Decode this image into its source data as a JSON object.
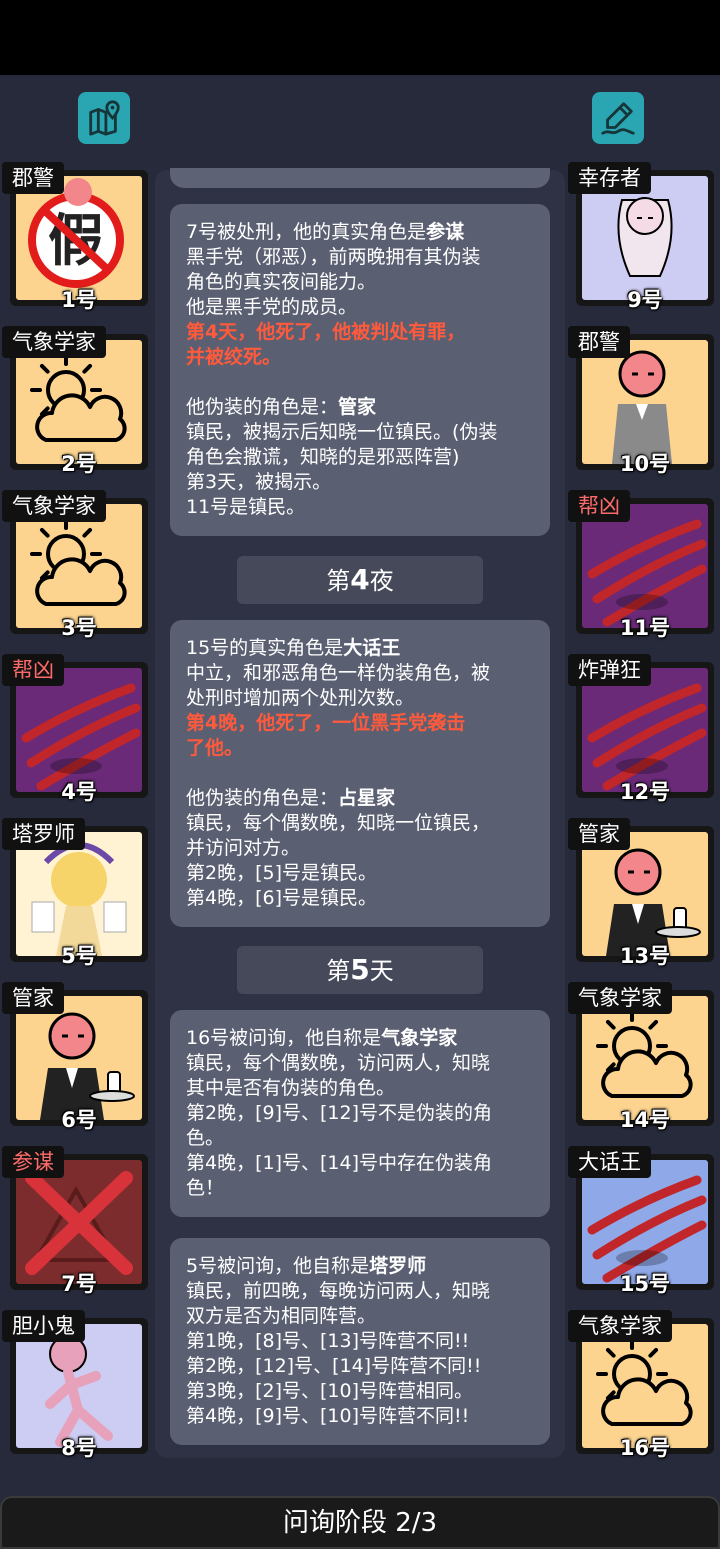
{
  "colors": {
    "accent": "#2aa6b3",
    "evil_role": "#ff6b6b",
    "highlight": "#ff5a3c"
  },
  "toolbar": {
    "left_icon": "map-pin-icon",
    "right_icon": "notepad-pen-icon"
  },
  "left_players": [
    {
      "role": "郡警",
      "num": "1号",
      "evil": false,
      "bg": "sand",
      "art": "fake"
    },
    {
      "role": "气象学家",
      "num": "2号",
      "evil": false,
      "bg": "sand",
      "art": "weather"
    },
    {
      "role": "气象学家",
      "num": "3号",
      "evil": false,
      "bg": "sand",
      "art": "weather"
    },
    {
      "role": "帮凶",
      "num": "4号",
      "evil": true,
      "bg": "purp",
      "art": "slash"
    },
    {
      "role": "塔罗师",
      "num": "5号",
      "evil": false,
      "bg": "tarot",
      "art": "tarot"
    },
    {
      "role": "管家",
      "num": "6号",
      "evil": false,
      "bg": "sand",
      "art": "butler"
    },
    {
      "role": "参谋",
      "num": "7号",
      "evil": true,
      "bg": "red",
      "art": "executed"
    },
    {
      "role": "胆小鬼",
      "num": "8号",
      "evil": false,
      "bg": "lav",
      "art": "coward"
    }
  ],
  "right_players": [
    {
      "role": "幸存者",
      "num": "9号",
      "evil": false,
      "bg": "lav",
      "art": "survivor"
    },
    {
      "role": "郡警",
      "num": "10号",
      "evil": false,
      "bg": "sand",
      "art": "sheriff"
    },
    {
      "role": "帮凶",
      "num": "11号",
      "evil": true,
      "bg": "purp",
      "art": "slash"
    },
    {
      "role": "炸弹狂",
      "num": "12号",
      "evil": false,
      "bg": "purp",
      "art": "slash"
    },
    {
      "role": "管家",
      "num": "13号",
      "evil": false,
      "bg": "sand",
      "art": "butler"
    },
    {
      "role": "气象学家",
      "num": "14号",
      "evil": false,
      "bg": "sand",
      "art": "weather"
    },
    {
      "role": "大话王",
      "num": "15号",
      "evil": false,
      "bg": "blue",
      "art": "slash"
    },
    {
      "role": "气象学家",
      "num": "16号",
      "evil": false,
      "bg": "sand",
      "art": "weather"
    }
  ],
  "log": {
    "entries": [
      {
        "lines": [
          {
            "t": "7号被处刑，他的真实角色是",
            "b": "参谋"
          },
          {
            "t": "黑手党（邪恶），前两晚拥有其伪装"
          },
          {
            "t": "角色的真实夜间能力。"
          },
          {
            "t": "他是黑手党的成员。"
          },
          {
            "t": "第4天，他死了，他被判处有罪，",
            "hl": true
          },
          {
            "t": "并被绞死。",
            "hl": true
          },
          {
            "t": ""
          },
          {
            "t": "他伪装的角色是：",
            "b": "管家"
          },
          {
            "t": "镇民，被揭示后知晓一位镇民。(伪装"
          },
          {
            "t": "角色会撒谎，知晓的是邪恶阵营)"
          },
          {
            "t": "第3天，被揭示。"
          },
          {
            "t": "11号是镇民。"
          }
        ]
      },
      {
        "lines": [
          {
            "t": "15号的真实角色是",
            "b": "大话王"
          },
          {
            "t": "中立，和邪恶角色一样伪装角色，被"
          },
          {
            "t": "处刑时增加两个处刑次数。"
          },
          {
            "t": "第4晚，他死了，一位黑手党袭击",
            "hl": true
          },
          {
            "t": "了他。",
            "hl": true
          },
          {
            "t": ""
          },
          {
            "t": "他伪装的角色是：",
            "b": "占星家"
          },
          {
            "t": "镇民，每个偶数晚，知晓一位镇民，"
          },
          {
            "t": "并访问对方。"
          },
          {
            "t": "第2晚，[5]号是镇民。"
          },
          {
            "t": "第4晚，[6]号是镇民。"
          }
        ]
      },
      {
        "lines": [
          {
            "t": "16号被问询，他自称是",
            "b": "气象学家"
          },
          {
            "t": "镇民，每个偶数晚，访问两人，知晓"
          },
          {
            "t": "其中是否有伪装的角色。"
          },
          {
            "t": "第2晚，[9]号、[12]号不是伪装的角"
          },
          {
            "t": "色。"
          },
          {
            "t": "第4晚，[1]号、[14]号中存在伪装角"
          },
          {
            "t": "色！"
          }
        ]
      },
      {
        "lines": [
          {
            "t": "5号被问询，他自称是",
            "b": "塔罗师"
          },
          {
            "t": "镇民，前四晚，每晚访问两人，知晓"
          },
          {
            "t": "双方是否为相同阵营。"
          },
          {
            "t": "第1晚，[8]号、[13]号阵营不同!!"
          },
          {
            "t": "第2晚，[12]号、[14]号阵营不同!!"
          },
          {
            "t": "第3晚，[2]号、[10]号阵营相同。"
          },
          {
            "t": "第4晚，[9]号、[10]号阵营不同!!"
          }
        ]
      }
    ],
    "dividers": [
      {
        "prefix": "第",
        "num": "4",
        "suffix": "夜"
      },
      {
        "prefix": "第",
        "num": "5",
        "suffix": "天"
      }
    ]
  },
  "phase": {
    "label": "问询阶段 2/3"
  }
}
